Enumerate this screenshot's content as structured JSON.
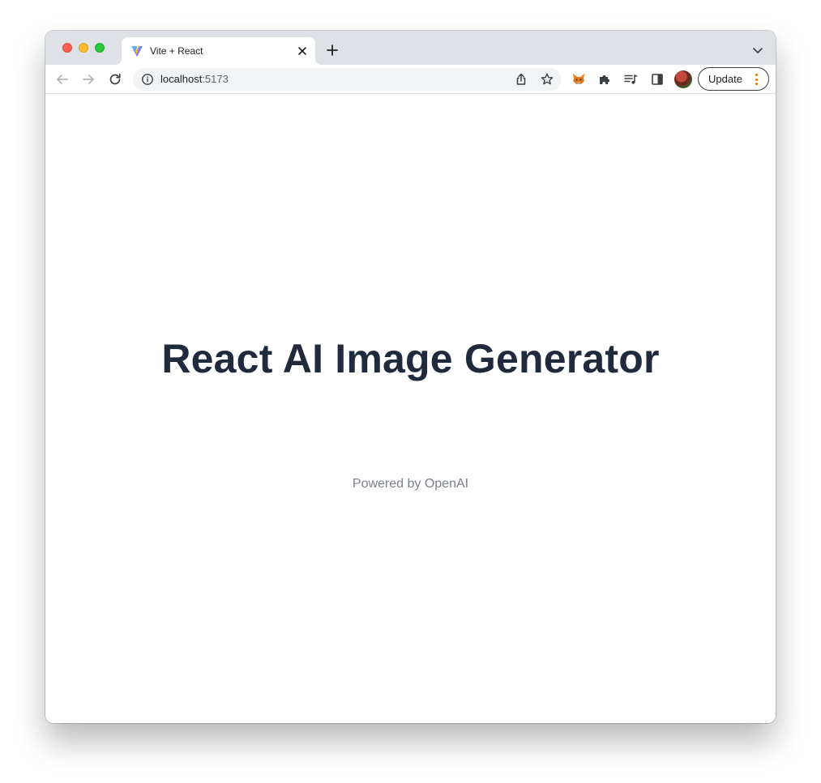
{
  "browser": {
    "tab": {
      "title": "Vite + React",
      "favicon": "vite-logo-icon"
    },
    "address_bar": {
      "host": "localhost",
      "port": ":5173"
    },
    "toolbar": {
      "update_label": "Update",
      "extensions": [
        "metamask-fox-icon",
        "puzzle-icon",
        "media-queue-icon",
        "side-panel-icon"
      ]
    },
    "colors": {
      "tabstrip": "#dee1e6",
      "kebab_accent": "#e37400"
    }
  },
  "page": {
    "heading": "React AI Image Generator",
    "powered_by": "Powered by OpenAI",
    "colors": {
      "heading": "#1f2a3c",
      "subtext": "#7a7f87"
    }
  }
}
